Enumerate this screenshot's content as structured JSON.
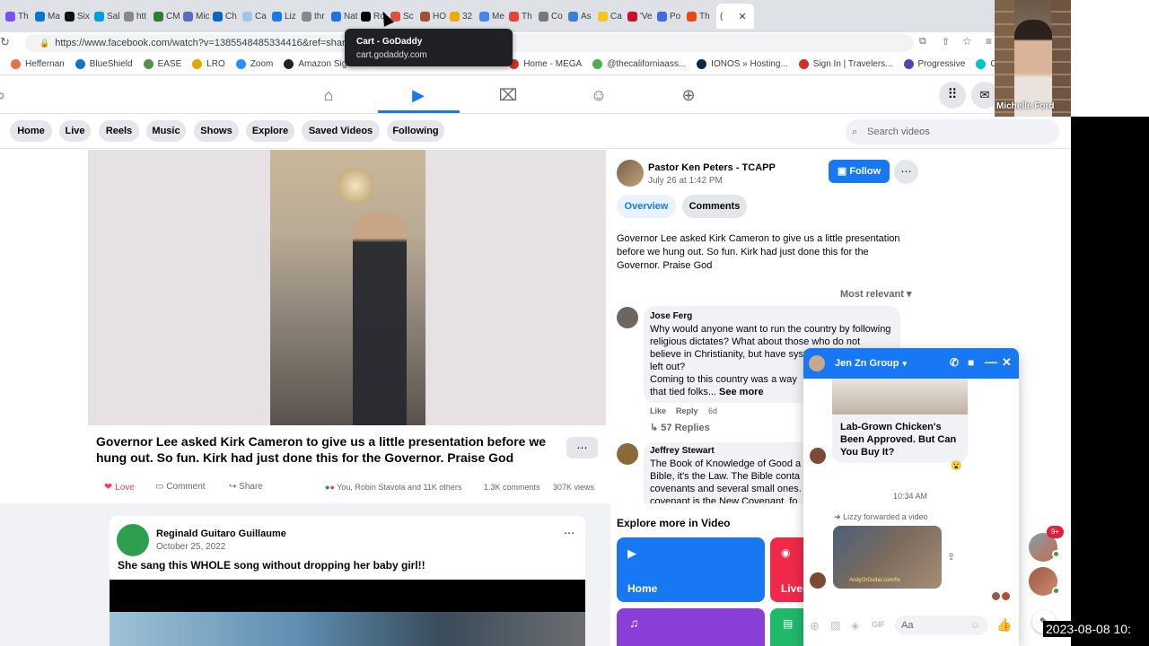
{
  "browser": {
    "tabs": [
      "Th",
      "Ma",
      "Six",
      "Sal",
      "htt",
      "CM",
      "Mic",
      "Ch",
      "Ca",
      "Liz",
      "thr",
      "Nat",
      "Ro",
      "Sc",
      "HO",
      "32",
      "Me",
      "Th",
      "Co",
      "As",
      "Ca",
      "'Ve",
      "Po",
      "Th"
    ],
    "active_tab": "(",
    "url": "https://www.facebook.com/watch?v=1385548485334416&ref=sharing",
    "tooltip_title": "Cart - GoDaddy",
    "tooltip_url": "cart.godaddy.com",
    "bookmarks": [
      "Heffernan",
      "BlueShield",
      "EASE",
      "LRO",
      "Zoom",
      "Amazon Sign-",
      "Home - MEGA",
      "@thecaliforniaass...",
      "IONOS » Hosting...",
      "Sign In | Travelers...",
      "Progressive",
      "Canva"
    ]
  },
  "fb_nav_pills": [
    "Home",
    "Live",
    "Reels",
    "Music",
    "Shows",
    "Explore",
    "Saved Videos",
    "Following"
  ],
  "search_placeholder": "Search videos",
  "post": {
    "author": "Pastor Ken Peters - TCAPP",
    "date": "July 26 at 1:42 PM",
    "follow": "Follow",
    "tab_overview": "Overview",
    "tab_comments": "Comments",
    "text": "Governor Lee asked Kirk Cameron to give us a little presentation before we hung out. So fun. Kirk had just done this for the Governor. Praise God",
    "title": "Governor Lee asked Kirk Cameron to give us a little presentation before we hung out. So fun. Kirk had just done this for the Governor. Praise God",
    "love": "Love",
    "comment": "Comment",
    "share": "Share",
    "reactions": "You, Robin Stavola and 11K others",
    "comments_count": "1.3K comments",
    "views": "307K views",
    "sort": "Most relevant"
  },
  "comments": [
    {
      "name": "Jose Ferg",
      "text": "Why would anyone want to run the country by following religious dictates? What about those who do not believe in Christianity, but have",
      "text2": "systems? They're just left out?",
      "text3": "Coming to this country was a way",
      "text4": "that tied folks...",
      "more": "See more",
      "like": "Like",
      "reply": "Reply",
      "age": "6d",
      "replies": "57 Replies"
    },
    {
      "name": "Jeffrey Stewart",
      "text": "The Book of Knowledge of Good a",
      "text2": "Bible, it's the Law. The Bible conta",
      "text3": "covenants and several small ones.",
      "text4": "covenant is the New Covenant, fo"
    }
  ],
  "feed_post": {
    "author": "Reginald Guitaro Guillaume",
    "date": "October 25, 2022",
    "text": "She sang this WHOLE song without dropping her baby girl!!"
  },
  "explore": {
    "title": "Explore more in Video",
    "tiles": [
      "Home",
      "Live"
    ]
  },
  "chat": {
    "title": "Jen Zn Group",
    "article": "Lab-Grown Chicken's Been Approved. But Can You Buy It?",
    "time": "10:34 AM",
    "forwarded": "Lizzy forwarded a video",
    "input_placeholder": "Aa",
    "badge": "9+",
    "video_caption": "AndyOrGuitar.com/fix"
  },
  "webcam": {
    "name": "Michelle Ford"
  },
  "timestamp": "2023-08-08 10:",
  "colors": {
    "fb_blue": "#1877f2",
    "love": "#f33e58"
  }
}
